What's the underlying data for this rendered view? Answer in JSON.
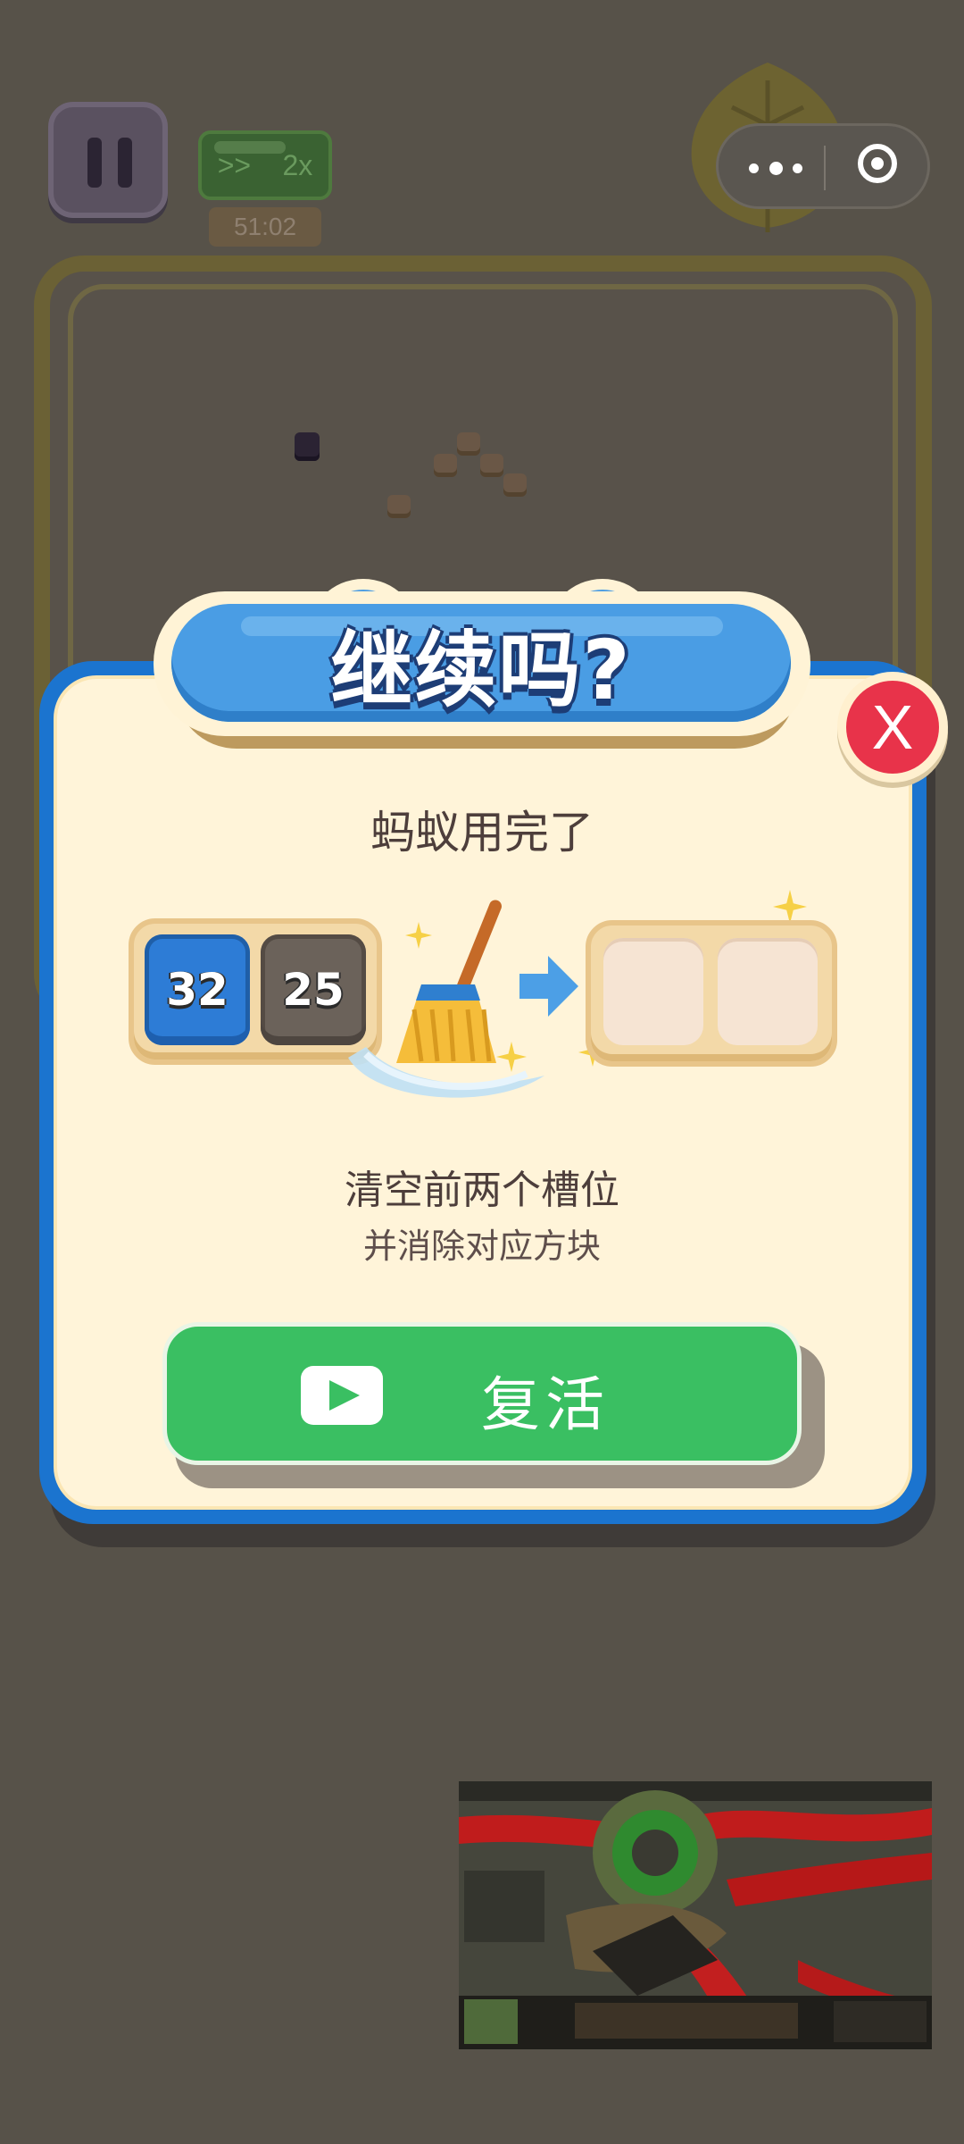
{
  "top_bar": {
    "speed_arrows": ">>",
    "speed_value": "2x",
    "timer": "51:02"
  },
  "dialog": {
    "title": "继续吗?",
    "close_label": "X",
    "subtitle": "蚂蚁用完了",
    "slots_before": [
      "32",
      "25"
    ],
    "description_line1": "清空前两个槽位",
    "description_line2": "并消除对应方块",
    "revive_label": "复活"
  },
  "colors": {
    "dialog_border": "#1b74cf",
    "dialog_fill": "#fff4d9",
    "banner": "#4a9de4",
    "close": "#e8334a",
    "revive": "#3abf62",
    "tile_blue": "#2d7cd6",
    "tile_gray": "#6b625a"
  },
  "icons": {
    "pause": "pause-icon",
    "menu": "more-dots-icon",
    "close_miniprogram": "target-circle-icon",
    "broom": "broom-icon",
    "arrow": "arrow-right-icon",
    "play": "video-play-icon",
    "sparkle": "sparkle-icon",
    "leaf": "leaf-icon"
  }
}
